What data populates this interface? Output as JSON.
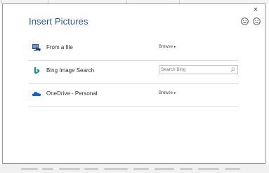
{
  "dialog": {
    "title": "Insert Pictures",
    "close_glyph": "×",
    "accent_color": "#2b579a",
    "feedback": {
      "smile_icon": "smile-icon",
      "frown_icon": "frown-icon"
    }
  },
  "sources": [
    {
      "label": "From a file",
      "icon": "computer-file-icon",
      "action_label": "Browse",
      "action_caret": "▸"
    },
    {
      "label": "Bing Image Search",
      "icon": "bing-icon",
      "search": {
        "placeholder": "Search Bing",
        "value": ""
      }
    },
    {
      "label": "OneDrive - Personal",
      "icon": "onedrive-icon",
      "action_label": "Browse",
      "action_caret": "▸"
    }
  ]
}
